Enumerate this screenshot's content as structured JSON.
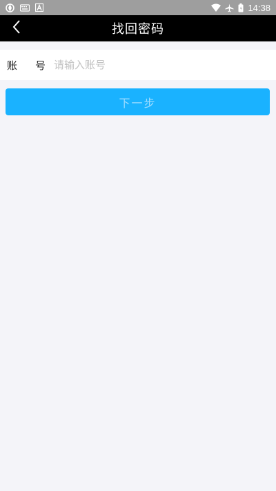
{
  "status_bar": {
    "time": "14:38",
    "left_icons": [
      "aperture-icon",
      "keyboard-icon",
      "a-badge-icon"
    ],
    "right_icons": [
      "wifi-icon",
      "airplane-icon",
      "battery-icon"
    ]
  },
  "header": {
    "title": "找回密码",
    "back_icon": "chevron-left-icon",
    "background": "#000000"
  },
  "form": {
    "account_label_1": "账",
    "account_label_2": "号",
    "account_placeholder": "请输入账号",
    "account_value": ""
  },
  "actions": {
    "next_label": "下一步",
    "next_color": "#1ab2ff"
  }
}
